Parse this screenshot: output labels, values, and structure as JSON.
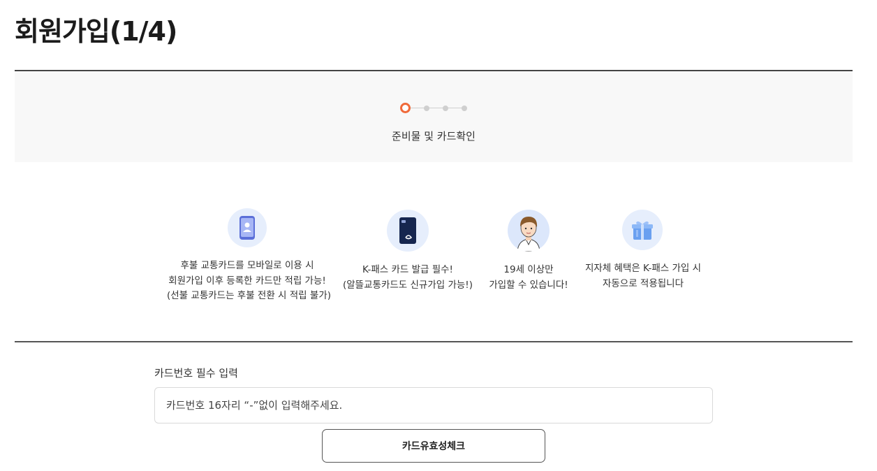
{
  "page": {
    "title": "회원가입(1/4)"
  },
  "steps": {
    "total": 4,
    "current": 1,
    "current_label": "준비물 및 카드확인",
    "accent_color": "#f06a3a"
  },
  "features": [
    {
      "icon": "mobile-phone-icon",
      "lines": [
        "후불 교통카드를 모바일로 이용 시",
        "회원가입 이후 등록한 카드만 적립 가능!",
        "(선불 교통카드는 후불 전환 시 적립 불가)"
      ]
    },
    {
      "icon": "transit-card-icon",
      "lines": [
        "K-패스 카드 발급 필수!",
        "(알뜰교통카드도 신규가입 가능!)"
      ]
    },
    {
      "icon": "person-avatar-icon",
      "lines": [
        "19세 이상만",
        "가입할 수 있습니다!"
      ]
    },
    {
      "icon": "gift-box-icon",
      "lines": [
        "지자체 혜택은 K-패스 가입 시",
        "자동으로 적용됩니다"
      ]
    }
  ],
  "card_form": {
    "label": "카드번호 필수 입력",
    "placeholder": "카드번호 16자리 “-”없이 입력해주세요.",
    "value": "",
    "check_button_label": "카드유효성체크"
  }
}
